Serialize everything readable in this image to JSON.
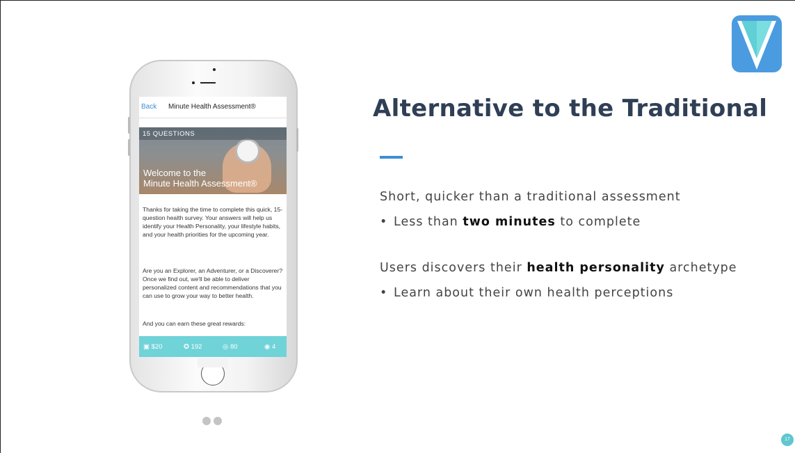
{
  "slide": {
    "title": "Alternative to the Traditional",
    "point1": "Short, quicker than a traditional assessment",
    "bullet1_pre": "Less than ",
    "bullet1_bold": "two minutes",
    "bullet1_post": " to complete",
    "point2_pre": "Users discovers their ",
    "point2_bold": "health personality",
    "point2_post": " archetype",
    "bullet2": "Learn about their own health perceptions",
    "page_number": "17"
  },
  "phone": {
    "back": "Back",
    "nav_title": "Minute Health Assessment®",
    "question_count": "15 QUESTIONS",
    "welcome_line1": "Welcome to the",
    "welcome_line2": "Minute Health Assessment®",
    "intro": "Thanks for taking the time to complete this quick, 15-question health survey. Your answers will help us identify your Health Personality, your lifestyle habits, and your health priorities for the upcoming year.",
    "archetype_text": "Are you an Explorer, an Adventurer, or a Discoverer? Once we find out, we'll be able to deliver personalized content and recommendations that you can use to grow your way to better health.",
    "rewards_intro": "And you can earn these great rewards:",
    "rewards": [
      "$20",
      "192",
      "80",
      "4"
    ]
  },
  "colors": {
    "title": "#2f3f55",
    "accent": "#3b8fd6",
    "teal": "#5ec7cf"
  }
}
